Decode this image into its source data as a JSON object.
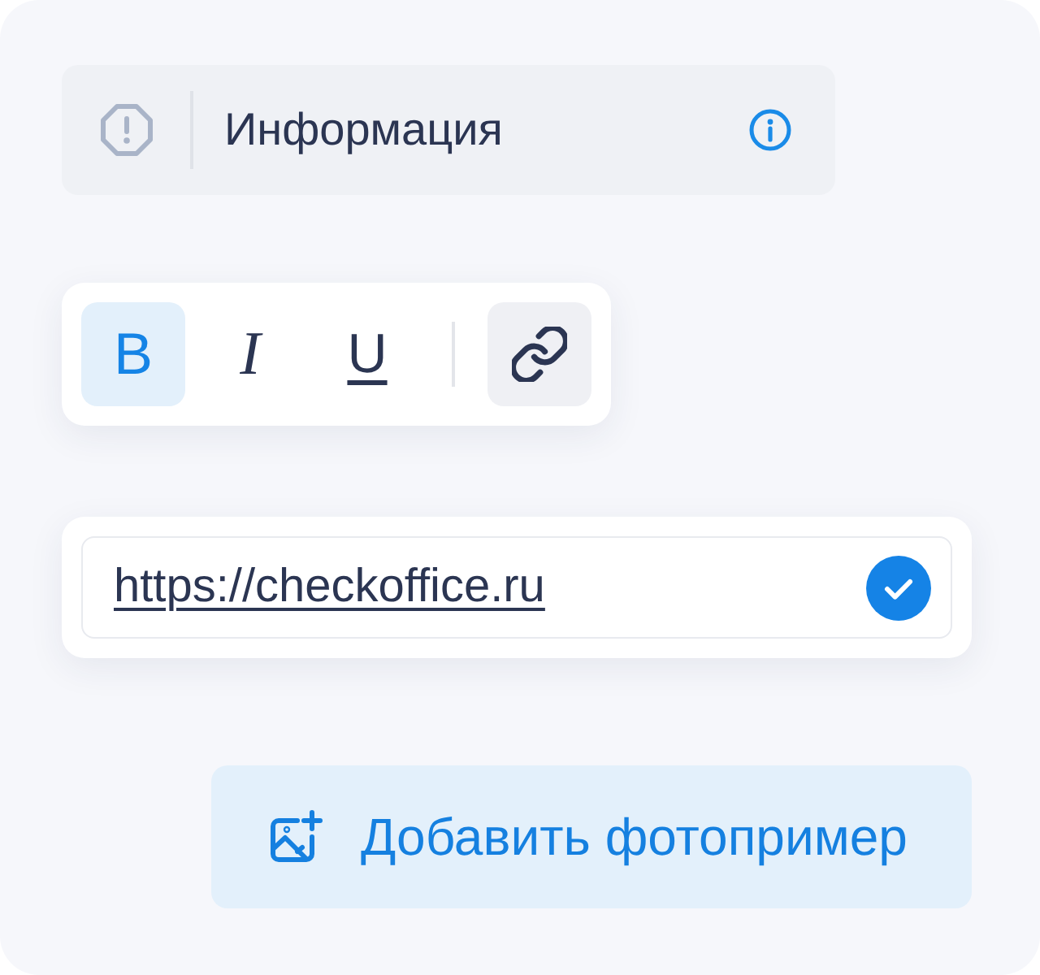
{
  "info_bar": {
    "label": "Информация"
  },
  "format_toolbar": {
    "groups": [
      {
        "buttons": [
          {
            "kind": "bold",
            "label": "B",
            "selected": true,
            "hovered": false
          },
          {
            "kind": "italic",
            "label": "I",
            "selected": false,
            "hovered": false
          },
          {
            "kind": "underline",
            "label": "U",
            "selected": false,
            "hovered": false
          }
        ]
      },
      {
        "buttons": [
          {
            "kind": "link",
            "selected": false,
            "hovered": true
          }
        ]
      }
    ]
  },
  "url_field": {
    "value": "https://checkoffice.ru",
    "valid": true
  },
  "add_photo_button": {
    "label": "Добавить фотопример"
  }
}
